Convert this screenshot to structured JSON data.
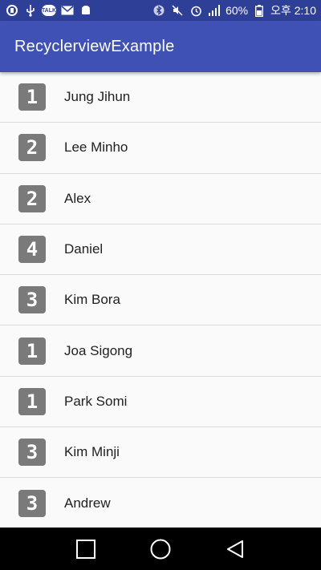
{
  "status_bar": {
    "talk_label": "TALK",
    "battery": "60%",
    "time": "오후 2:10"
  },
  "app_bar": {
    "title": "RecyclerviewExample"
  },
  "list": {
    "items": [
      {
        "number": "1",
        "name": "Jung Jihun"
      },
      {
        "number": "2",
        "name": "Lee Minho"
      },
      {
        "number": "2",
        "name": "Alex"
      },
      {
        "number": "4",
        "name": "Daniel"
      },
      {
        "number": "3",
        "name": "Kim Bora"
      },
      {
        "number": "1",
        "name": "Joa Sigong"
      },
      {
        "number": "1",
        "name": "Park Somi"
      },
      {
        "number": "3",
        "name": "Kim Minji"
      },
      {
        "number": "3",
        "name": "Andrew"
      }
    ]
  },
  "colors": {
    "status_bar": "#2e3f98",
    "app_bar": "#3f51b5",
    "badge": "#7a7a7a",
    "nav_bar": "#000000"
  },
  "icons": {
    "status_left": [
      "app-notification-icon",
      "usb-icon",
      "talk-icon",
      "mail-icon",
      "android-icon"
    ],
    "status_right": [
      "bluetooth-icon",
      "mute-icon",
      "alarm-icon",
      "signal-icon",
      "battery-icon"
    ],
    "nav": [
      "recent-apps-icon",
      "home-icon",
      "back-icon"
    ]
  }
}
